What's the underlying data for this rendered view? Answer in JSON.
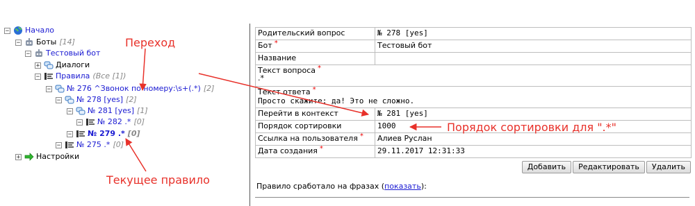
{
  "tree": {
    "root": {
      "label": "Начало"
    },
    "bots": {
      "label": "Боты",
      "count": "[14]"
    },
    "test_bot": {
      "label": "Тестовый бот"
    },
    "dialogs": {
      "label": "Диалоги"
    },
    "rules": {
      "label": "Правила",
      "count": "(Все [1])"
    },
    "r276": {
      "label": "№ 276 ^Звонок по номеру:\\s+(.*)",
      "count": "[2]"
    },
    "r278": {
      "label": "№ 278 [yes]",
      "count": "[2]"
    },
    "r281": {
      "label": "№ 281 [yes]",
      "count": "[1]"
    },
    "r282": {
      "label": "№ 282 .*",
      "count": "[0]"
    },
    "r279": {
      "label": "№ 279 .*",
      "count": "[0]"
    },
    "r275": {
      "label": "№ 275 .*",
      "count": "[0]"
    },
    "settings": {
      "label": "Настройки"
    }
  },
  "details": {
    "parent_q": {
      "key": "Родительский вопрос",
      "value": "№ 278 [yes]"
    },
    "bot": {
      "key": "Бот",
      "value": "Тестовый бот",
      "req": "*"
    },
    "name": {
      "key": "Название",
      "value": ""
    },
    "q_text": {
      "key": "Текст вопроса",
      "value": ".*",
      "req": "*"
    },
    "a_text": {
      "key": "Текст ответа",
      "value": "Просто скажите: да! Это не сложно.",
      "req": "*"
    },
    "goto": {
      "key": "Перейти в контекст",
      "value": "№ 281 [yes]"
    },
    "sort": {
      "key": "Порядок сортировки",
      "value": "1000"
    },
    "user_link": {
      "key": "Ссылка на пользователя",
      "value": "Алиев Руслан",
      "req": "*"
    },
    "created": {
      "key": "Дата создания",
      "value": "29.11.2017 12:31:33",
      "req": "*"
    }
  },
  "buttons": {
    "add": "Добавить",
    "edit": "Редактировать",
    "delete": "Удалить"
  },
  "phrases": {
    "prefix": "Правило сработало на фразах (",
    "link": "показать",
    "suffix": "):"
  },
  "annotations": {
    "transition": "Переход",
    "sort_order": "Порядок сортировки для \".*\"",
    "current_rule": "Текущее правило",
    "color": "#e8312a"
  },
  "colors": {
    "link": "#1a1ad2",
    "required": "#e00000"
  }
}
